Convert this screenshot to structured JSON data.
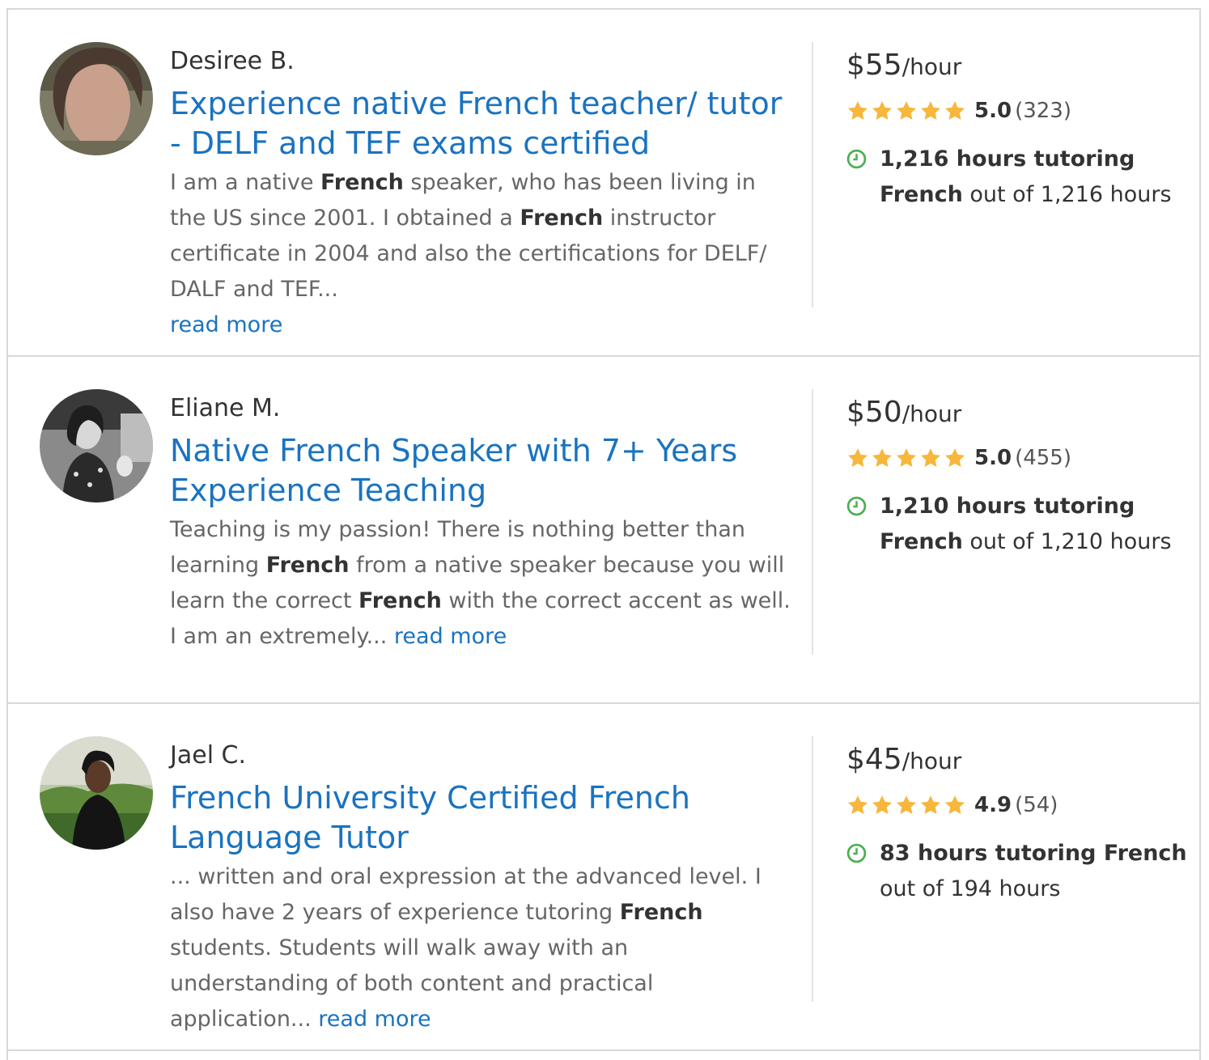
{
  "colors": {
    "link": "#1a73c0",
    "star": "#f6b73c",
    "clock": "#4caf50",
    "divider": "#d8d8d8"
  },
  "icons": {
    "rating": "star-icon",
    "hours": "clock-icon"
  },
  "tutors": [
    {
      "name": "Desiree B.",
      "title": "Experience native French teacher/ tutor - DELF and TEF exams certified",
      "bio": [
        {
          "t": "I am a native ",
          "b": false
        },
        {
          "t": "French",
          "b": true
        },
        {
          "t": " speaker, who has been living in the US since 2001. I obtained a ",
          "b": false
        },
        {
          "t": "French",
          "b": true
        },
        {
          "t": " instructor certificate in 2004 and also the certifications for DELF/ DALF and TEF...",
          "b": false
        }
      ],
      "bio_break_before_link": true,
      "read_more": "read more",
      "price": "$55",
      "price_unit": "/hour",
      "stars": 5,
      "rating": "5.0",
      "reviews": "(323)",
      "hours_bold": "1,216 hours tutoring French",
      "hours_rest": " out of 1,216 hours"
    },
    {
      "name": "Eliane M.",
      "title": "Native French Speaker with 7+ Years Experience Teaching",
      "bio": [
        {
          "t": "Teaching is my passion! There is nothing better than learning ",
          "b": false
        },
        {
          "t": "French",
          "b": true
        },
        {
          "t": " from a native speaker because you will learn the correct ",
          "b": false
        },
        {
          "t": "French",
          "b": true
        },
        {
          "t": " with the correct accent as well. I am an extremely...",
          "b": false
        }
      ],
      "bio_break_before_link": false,
      "read_more": "read more",
      "price": "$50",
      "price_unit": "/hour",
      "stars": 5,
      "rating": "5.0",
      "reviews": "(455)",
      "hours_bold": "1,210 hours tutoring French",
      "hours_rest": " out of 1,210 hours"
    },
    {
      "name": "Jael C.",
      "title": "French University Certified French Language Tutor",
      "bio": [
        {
          "t": "... written and oral expression at the advanced level. I also have 2 years of experience tutoring ",
          "b": false
        },
        {
          "t": "French",
          "b": true
        },
        {
          "t": " students. Students will walk away with an understanding of both content and practical application...",
          "b": false
        }
      ],
      "bio_break_before_link": false,
      "read_more": "read more",
      "price": "$45",
      "price_unit": "/hour",
      "stars": 5,
      "rating": "4.9",
      "reviews": "(54)",
      "hours_bold": "83 hours tutoring French",
      "hours_rest": " out of 194 hours"
    }
  ]
}
